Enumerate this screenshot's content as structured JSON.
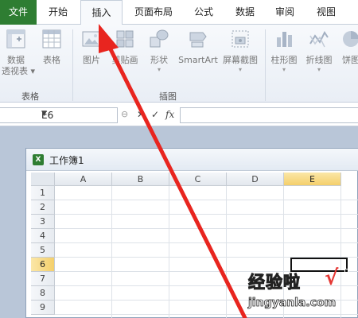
{
  "tabs": [
    {
      "label": "文件"
    },
    {
      "label": "开始"
    },
    {
      "label": "插入"
    },
    {
      "label": "页面布局"
    },
    {
      "label": "公式"
    },
    {
      "label": "数据"
    },
    {
      "label": "审阅"
    },
    {
      "label": "视图"
    }
  ],
  "ribbon": {
    "tables_group": {
      "label": "表格",
      "pivot_label_1": "数据",
      "pivot_label_2": "透视表",
      "table_label": "表格"
    },
    "illustrations_group": {
      "label": "插图",
      "picture_label": "图片",
      "clipart_label": "剪贴画",
      "shapes_label": "形状",
      "smartart_label": "SmartArt",
      "screenshot_label": "屏幕截图"
    },
    "charts_group": {
      "column_label": "柱形图",
      "line_label": "折线图",
      "pie_label": "饼图"
    }
  },
  "formula_bar": {
    "name_box": "E6",
    "fx_label": "fx"
  },
  "workbook": {
    "title": "工作簿1",
    "columns": [
      "A",
      "B",
      "C",
      "D",
      "E"
    ],
    "rows": [
      "1",
      "2",
      "3",
      "4",
      "5",
      "6",
      "7",
      "8",
      "9"
    ],
    "selected_column": "E",
    "selected_row": "6"
  },
  "watermark": {
    "line1": "经验啦",
    "line2": "jingyanla.com",
    "check": "√"
  },
  "colors": {
    "file_tab": "#2e7d32",
    "arrow": "#e8251f",
    "selection_header": "#f4cf6a"
  }
}
